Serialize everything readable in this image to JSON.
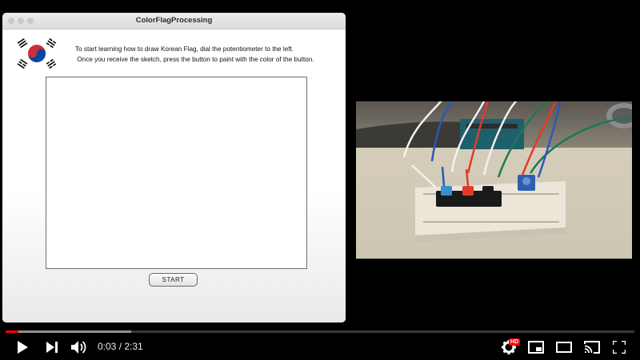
{
  "window": {
    "title": "ColorFlagProcessing",
    "instructions": [
      "To start learning how to draw Korean Flag, dial the potentiometer to the left.",
      " Once you receive the sketch, press the button to paint with the color of the button."
    ],
    "start_label": "START"
  },
  "player": {
    "current_time": "0:03",
    "separator": " / ",
    "duration": "2:31",
    "played_fraction": 0.02,
    "loaded_fraction": 0.2,
    "quality_badge": "HD"
  },
  "icons": {
    "play": "play-icon",
    "next": "next-icon",
    "volume": "volume-icon",
    "settings": "settings-icon",
    "miniplayer": "miniplayer-icon",
    "theater": "theater-mode-icon",
    "cast": "cast-icon",
    "fullscreen": "fullscreen-icon"
  },
  "colors": {
    "progress_played": "#ff0000",
    "hd_badge": "#ff0000",
    "flag_red": "#cd2e3a",
    "flag_blue": "#0047a0"
  }
}
